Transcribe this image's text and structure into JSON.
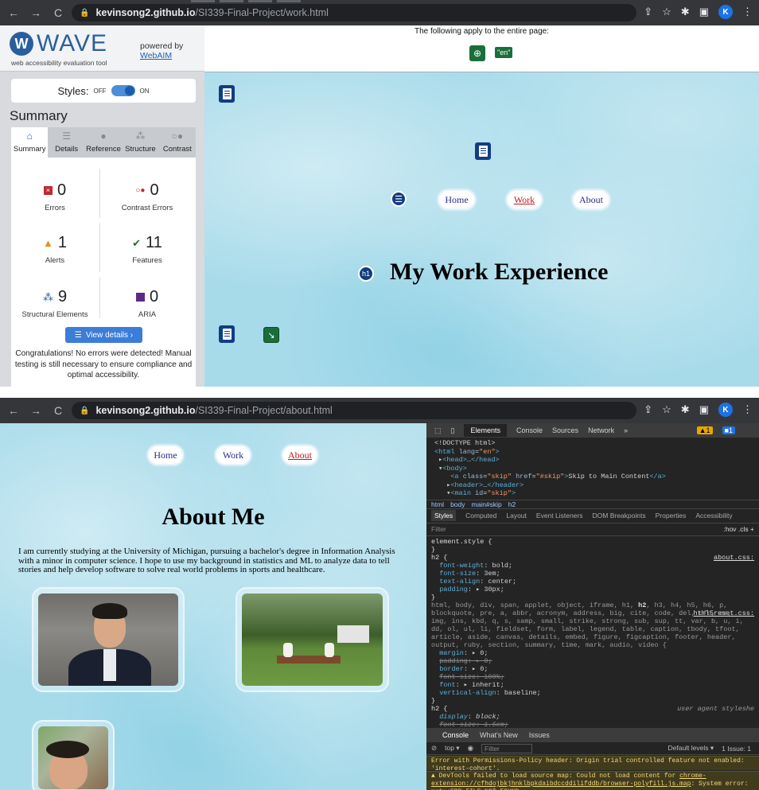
{
  "window1": {
    "url_host": "kevinsong2.github.io",
    "url_path": "/SI339-Final-Project/work.html",
    "avatar_letter": "K",
    "wave": {
      "logo_text": "WAVE",
      "tagline": "web accessibility evaluation tool",
      "powered_by": "powered by",
      "webaim": "WebAIM",
      "styles_label": "Styles:",
      "styles_off": "OFF",
      "styles_on": "ON",
      "summary_heading": "Summary",
      "tabs": [
        {
          "label": "Summary",
          "icon": "home-icon"
        },
        {
          "label": "Details",
          "icon": "list-icon"
        },
        {
          "label": "Reference",
          "icon": "info-icon"
        },
        {
          "label": "Structure",
          "icon": "hierarchy-icon"
        },
        {
          "label": "Contrast",
          "icon": "contrast-icon"
        }
      ],
      "stats": {
        "errors": {
          "value": "0",
          "label": "Errors"
        },
        "contrast_errors": {
          "value": "0",
          "label": "Contrast Errors"
        },
        "alerts": {
          "value": "1",
          "label": "Alerts"
        },
        "features": {
          "value": "11",
          "label": "Features"
        },
        "structural": {
          "value": "9",
          "label": "Structural Elements"
        },
        "aria": {
          "value": "0",
          "label": "ARIA"
        }
      },
      "view_details": "View details ›",
      "congrats": "Congratulations! No errors were detected! Manual testing is still necessary to ensure compliance and optimal accessibility."
    },
    "page": {
      "notice": "The following apply to the entire page:",
      "lang_badge": "\"en\"",
      "nav": [
        "Home",
        "Work",
        "About"
      ],
      "h1_badge": "h1",
      "heading": "My Work Experience"
    }
  },
  "window2": {
    "url_host": "kevinsong2.github.io",
    "url_path": "/SI339-Final-Project/about.html",
    "avatar_letter": "K",
    "page": {
      "nav": [
        "Home",
        "Work",
        "About"
      ],
      "heading": "About Me",
      "paragraph": "I am currently studying at the University of Michigan, pursuing a bachelor's degree in Information Analysis with a minor in computer science. I hope to use my background in statistics and ML to analyze data to tell stories and help develop software to solve real world problems in sports and healthcare."
    },
    "devtools": {
      "tabs": [
        "Elements",
        "Console",
        "Sources",
        "Network",
        "»"
      ],
      "warn_count": "1",
      "info_count": "1",
      "breadcrumbs": [
        "html",
        "body",
        "main#skip",
        "h2"
      ],
      "sub_tabs": [
        "Styles",
        "Computed",
        "Layout",
        "Event Listeners",
        "DOM Breakpoints",
        "Properties",
        "Accessibility"
      ],
      "filter": "Filter",
      "filter_right": ":hov  .cls  +",
      "console_tabs": [
        "Console",
        "What's New",
        "Issues"
      ],
      "console_context": "top ▾",
      "console_filter": "Filter",
      "default_levels": "Default levels ▾",
      "issues": "1 Issue: 1",
      "msg1": "Error with Permissions-Policy header: Origin trial controlled feature not enabled: 'interest-cohort'.",
      "msg2_a": "DevTools failed to load source map: Could not load content for ",
      "msg2_link": "chrome-extension://cfhdojbkjhnklbpkdaibdccddilifddb/browser-polyfill.js.map",
      "msg2_b": ": System error: net::ERR_FILE_NOT_FOUND"
    }
  },
  "colors": {
    "wave_blue": "#2a5f9e",
    "error_red": "#c0292d",
    "alert_orange": "#e7901a",
    "feature_green": "#1a6e3a",
    "aria_purple": "#5b2a86",
    "page_bg": "#a8dbea"
  }
}
